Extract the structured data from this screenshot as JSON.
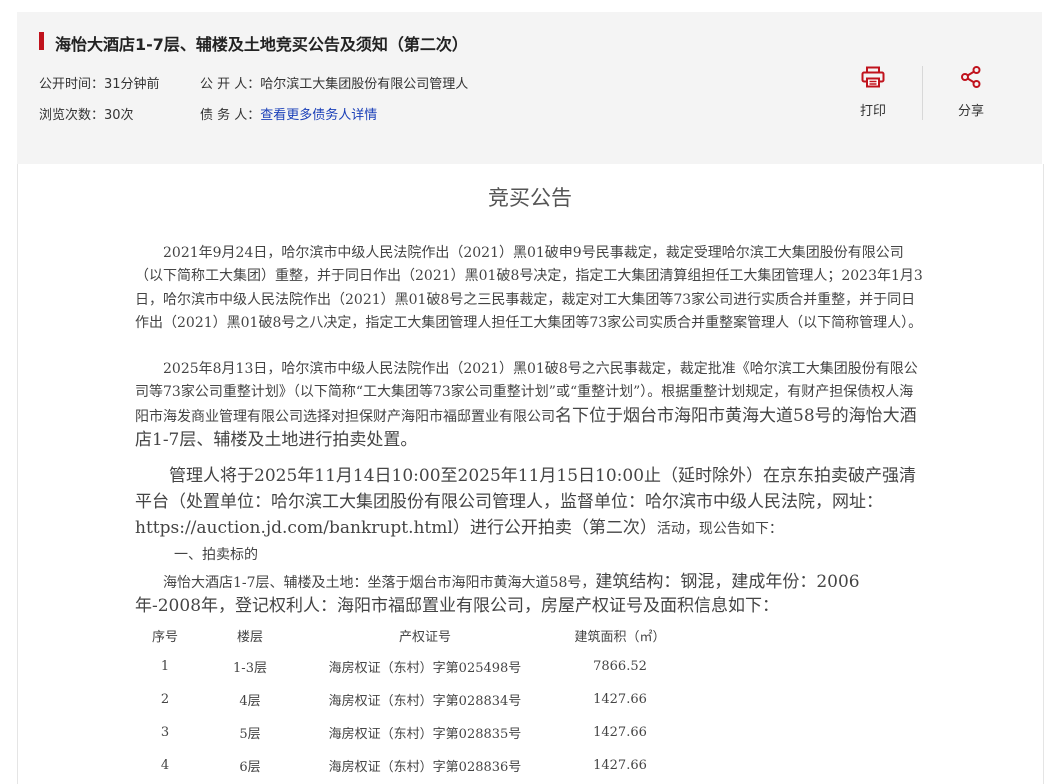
{
  "header": {
    "title": "海怡大酒店1-7层、辅楼及土地竞买公告及须知（第二次）",
    "publish_time_label": "公开时间：",
    "publish_time_value": "31分钟前",
    "view_count_label": "浏览次数：",
    "view_count_value": "30次",
    "publisher_label": "公 开 人：",
    "publisher_value": "哈尔滨工大集团股份有限公司管理人",
    "debtor_label": "债 务 人：",
    "debtor_link": "查看更多债务人详情",
    "print_label": "打印",
    "share_label": "分享"
  },
  "colors": {
    "accent": "#c0121c",
    "link": "#1a3fb8"
  },
  "document": {
    "title": "竞买公告",
    "p1": "2021年9月24日，哈尔滨市中级人民法院作出（2021）黑01破申9号民事裁定，裁定受理哈尔滨工大集团股份有限公司（以下简称工大集团）重整，并于同日作出（2021）黑01破8号决定，指定工大集团清算组担任工大集团管理人；2023年1月3日，哈尔滨市中级人民法院作出（2021）黑01破8号之三民事裁定，裁定对工大集团等73家公司进行实质合并重整，并于同日作出（2021）黑01破8号之八决定，指定工大集团管理人担任工大集团等73家公司实质合并重整案管理人（以下简称管理人）。",
    "p2a": "2025年8月13日，哈尔滨市中级人民法院作出（2021）黑01破8号之六民事裁定，裁定批准《哈尔滨工大集团股份有限公司等73家公司重整计划》（以下简称“工大集团等73家公司重整计划”或“重整计划”）。根据重整计划规定，有财产担保债权人海阳市海发商业管理有限公司选择对担保财产海阳市福邸置业有限公司",
    "p2b": "名下位于烟台市海阳市黄海大道58号的海怡大酒店1-7层、辅楼及土地进行拍卖处置。",
    "p3a": "管理人将于2025年11月14日10:00至2025年11月15日10:00止（延时除外）在京东拍卖破产强清平台（处置单位：哈尔滨工大集团股份有限公司管理人，监督单位：哈尔滨市中级人民法院，网址：https://auction.jd.com/bankrupt.html）进行公开拍卖（第二次）",
    "p3b": "活动，现公告如下：",
    "section1": "一、拍卖标的",
    "p4a": "海怡大酒店1-7层、辅楼及土地：坐落于烟台市海阳市黄海大道58号，",
    "p4b": "建筑结构：钢混，建成年份：",
    "p4c": "2006年-2008年，登记权利人：海阳市福邸置业有限公司，房屋产权证号及面积信息如下："
  },
  "table": {
    "headers": [
      "序号",
      "楼层",
      "产权证号",
      "建筑面积（㎡）"
    ],
    "rows": [
      [
        "1",
        "1-3层",
        "海房权证（东村）字第025498号",
        "7866.52"
      ],
      [
        "2",
        "4层",
        "海房权证（东村）字第028834号",
        "1427.66"
      ],
      [
        "3",
        "5层",
        "海房权证（东村）字第028835号",
        "1427.66"
      ],
      [
        "4",
        "6层",
        "海房权证（东村）字第028836号",
        "1427.66"
      ]
    ]
  }
}
